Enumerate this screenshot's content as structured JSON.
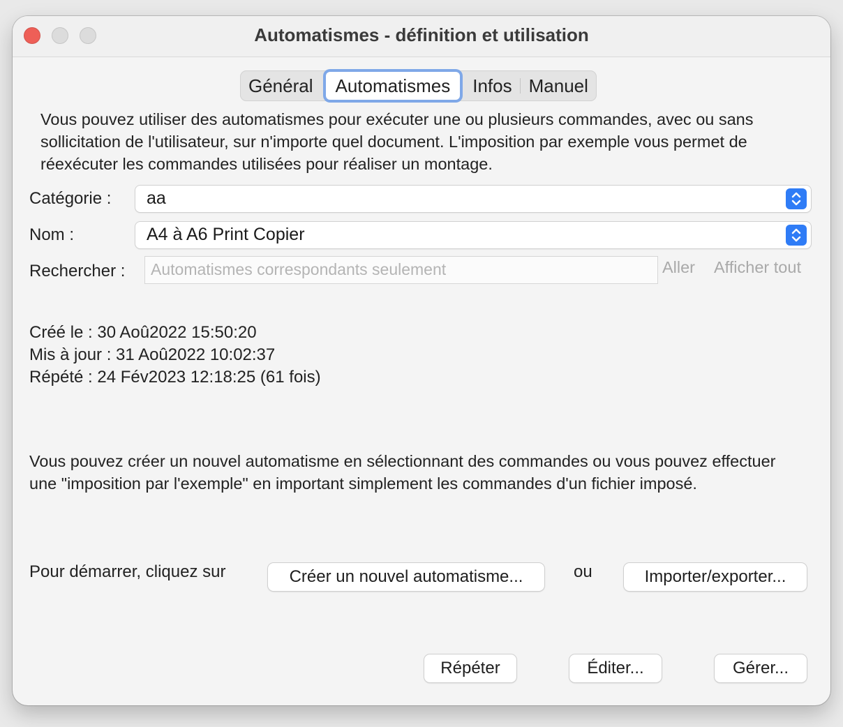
{
  "window": {
    "title": "Automatismes - définition et utilisation"
  },
  "tabs": [
    {
      "label": "Général",
      "selected": false
    },
    {
      "label": "Automatismes",
      "selected": true
    },
    {
      "label": "Infos",
      "selected": false
    },
    {
      "label": "Manuel",
      "selected": false
    }
  ],
  "intro_text": "Vous pouvez utiliser des automatismes pour exécuter une ou plusieurs commandes, avec ou sans sollicitation de l'utilisateur, sur n'importe quel document. L'imposition par exemple vous permet de réexécuter les commandes utilisées pour réaliser un montage.",
  "form": {
    "category_label": "Catégorie :",
    "category_value": "aa",
    "name_label": "Nom :",
    "name_value": "A4 à A6 Print Copier",
    "search_label": "Rechercher :",
    "search_placeholder": "Automatismes correspondants seulement",
    "search_value": "",
    "go_label": "Aller",
    "show_all_label": "Afficher tout"
  },
  "info": {
    "created": "Créé le : 30 Aoû2022  15:50:20",
    "updated": "Mis à jour : 31 Aoû2022  10:02:37",
    "repeated": "Répété : 24 Fév2023  12:18:25 (61 fois)"
  },
  "create_text": "Vous pouvez créer un nouvel automatisme en sélectionnant des commandes ou vous pouvez effectuer une \"imposition par l'exemple\" en important simplement les commandes d'un fichier imposé.",
  "start": {
    "label": "Pour démarrer, cliquez sur",
    "create_button": "Créer un nouvel automatisme...",
    "or_label": "ou",
    "import_button": "Importer/exporter..."
  },
  "footer": {
    "repeat_button": "Répéter",
    "edit_button": "Éditer...",
    "manage_button": "Gérer..."
  },
  "colors": {
    "accent": "#2f7cf6",
    "close": "#ee5f57",
    "focus_ring": "#7fa8e8"
  }
}
